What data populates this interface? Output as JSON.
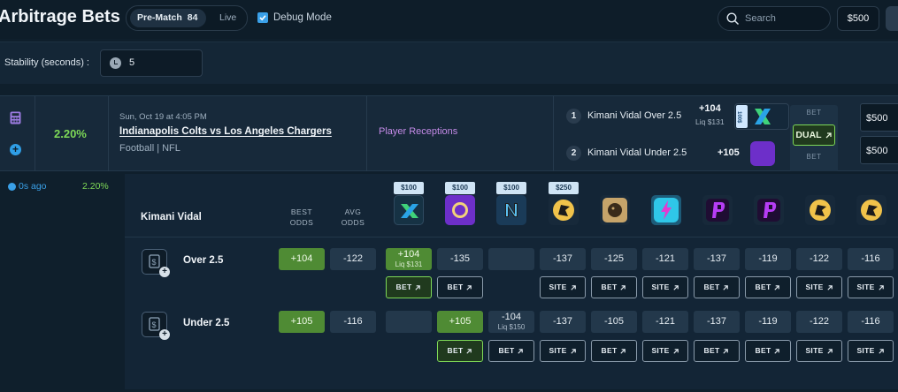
{
  "header": {
    "title": "Arbitrage Bets",
    "mode_prematch": "Pre-Match",
    "mode_prematch_count": "84",
    "mode_live": "Live",
    "debug_label": "Debug Mode",
    "search_placeholder": "Search",
    "bankroll": "$500"
  },
  "stability": {
    "label": "Stability (seconds) :",
    "value": "5"
  },
  "arb": {
    "percent": "2.20%",
    "date": "Sun, Oct 19 at 4:05 PM",
    "match": "Indianapolis Colts vs Los Angeles Chargers",
    "league": "Football | NFL",
    "market": "Player Receptions",
    "legs": [
      {
        "num": "1",
        "desc": "Kimani Vidal Over 2.5",
        "odds": "+104",
        "liq": "Liq $131",
        "book_tag": "100$"
      },
      {
        "num": "2",
        "desc": "Kimani Vidal Under 2.5",
        "odds": "+105",
        "book_tag": "Hard Rock"
      }
    ],
    "bet_top": "BET",
    "dual_label": "DUAL",
    "bet_bottom": "BET",
    "stakes": [
      "$500",
      "$500"
    ]
  },
  "detail": {
    "updated": "0s ago",
    "updated_pct": "2.20%",
    "player": "Kimani Vidal",
    "col_best": "BEST ODDS",
    "col_avg": "AVG ODDS",
    "limits": [
      "$100",
      "$100",
      "$100",
      "$250"
    ],
    "rows": [
      {
        "label": "Over 2.5",
        "best": "+104",
        "avg": "-122",
        "cells": [
          {
            "top": "+104",
            "sub": "Liq $131"
          },
          {
            "top": "-135"
          },
          {
            "top": ""
          },
          {
            "top": "-137"
          },
          {
            "top": "-125"
          },
          {
            "top": "-121"
          },
          {
            "top": "-137"
          },
          {
            "top": "-119"
          },
          {
            "top": "-122"
          },
          {
            "top": "-116"
          }
        ],
        "actions": [
          "BET",
          "BET",
          "",
          "SITE",
          "BET",
          "SITE",
          "BET",
          "BET",
          "SITE",
          "SITE"
        ]
      },
      {
        "label": "Under 2.5",
        "best": "+105",
        "avg": "-116",
        "cells": [
          {
            "top": ""
          },
          {
            "top": "+105"
          },
          {
            "top": "-104",
            "sub": "Liq $150"
          },
          {
            "top": "-137"
          },
          {
            "top": "-105"
          },
          {
            "top": "-121"
          },
          {
            "top": "-137"
          },
          {
            "top": "-119"
          },
          {
            "top": "-122"
          },
          {
            "top": "-116"
          }
        ],
        "actions": [
          "",
          "BET",
          "BET",
          "SITE",
          "BET",
          "SITE",
          "BET",
          "BET",
          "SITE",
          "SITE"
        ]
      }
    ]
  },
  "colors": {
    "accent_green": "#7ed957",
    "best_green": "#4f8b34",
    "accent_blue": "#3aa0e8",
    "market_purple": "#c58be8"
  }
}
